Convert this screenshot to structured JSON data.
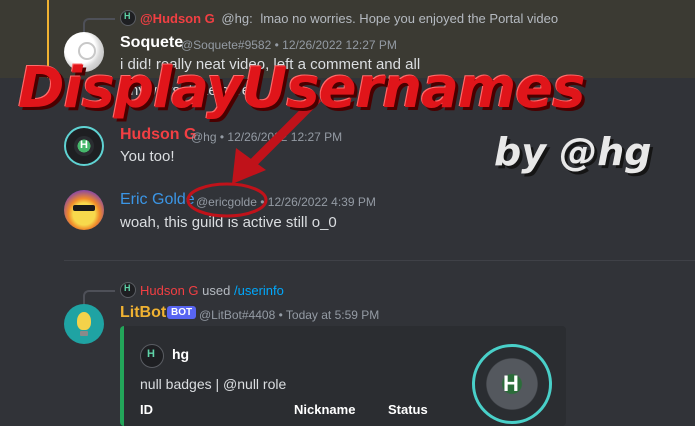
{
  "messages": [
    {
      "reply": {
        "author": "@Hudson G",
        "handle": "@hg:",
        "text": "lmao no worries. Hope you enjoyed the Portal video"
      },
      "author": "Soquete",
      "handle": "@Soquete#9582",
      "timestamp": "12/26/2022 12:27 PM",
      "lines": [
        "i did! really neat video, left a comment and all",
        "Anyways, take care!"
      ]
    },
    {
      "author": "Hudson G",
      "handle": "@hg",
      "timestamp": "12/26/2022 12:27 PM",
      "lines": [
        "You too!"
      ]
    },
    {
      "author": "Eric Golde",
      "handle": "@ericgolde",
      "timestamp": "12/26/2022 4:39 PM",
      "lines": [
        "woah, this guild is active still o_0"
      ]
    },
    {
      "interaction": {
        "user": "Hudson G",
        "verb": "used",
        "command": "/userinfo"
      },
      "author": "LitBot",
      "badge": "BOT",
      "handle": "@LitBot#4408",
      "timestamp": "Today at 5:59 PM",
      "embed": {
        "title": "hg",
        "description": "null badges | @null role",
        "fields": [
          "ID",
          "Nickname",
          "Status"
        ]
      }
    }
  ],
  "overlay": {
    "title": "DisplayUsernames",
    "byline": "by @hg"
  },
  "colors": {
    "background": "#313338",
    "soquete": "#ffffff",
    "hudson": "#f23f43",
    "eric": "#3b96e6",
    "litbot": "#f0b232",
    "embed_border": "#23a559",
    "overlay_red": "#e0151a"
  }
}
